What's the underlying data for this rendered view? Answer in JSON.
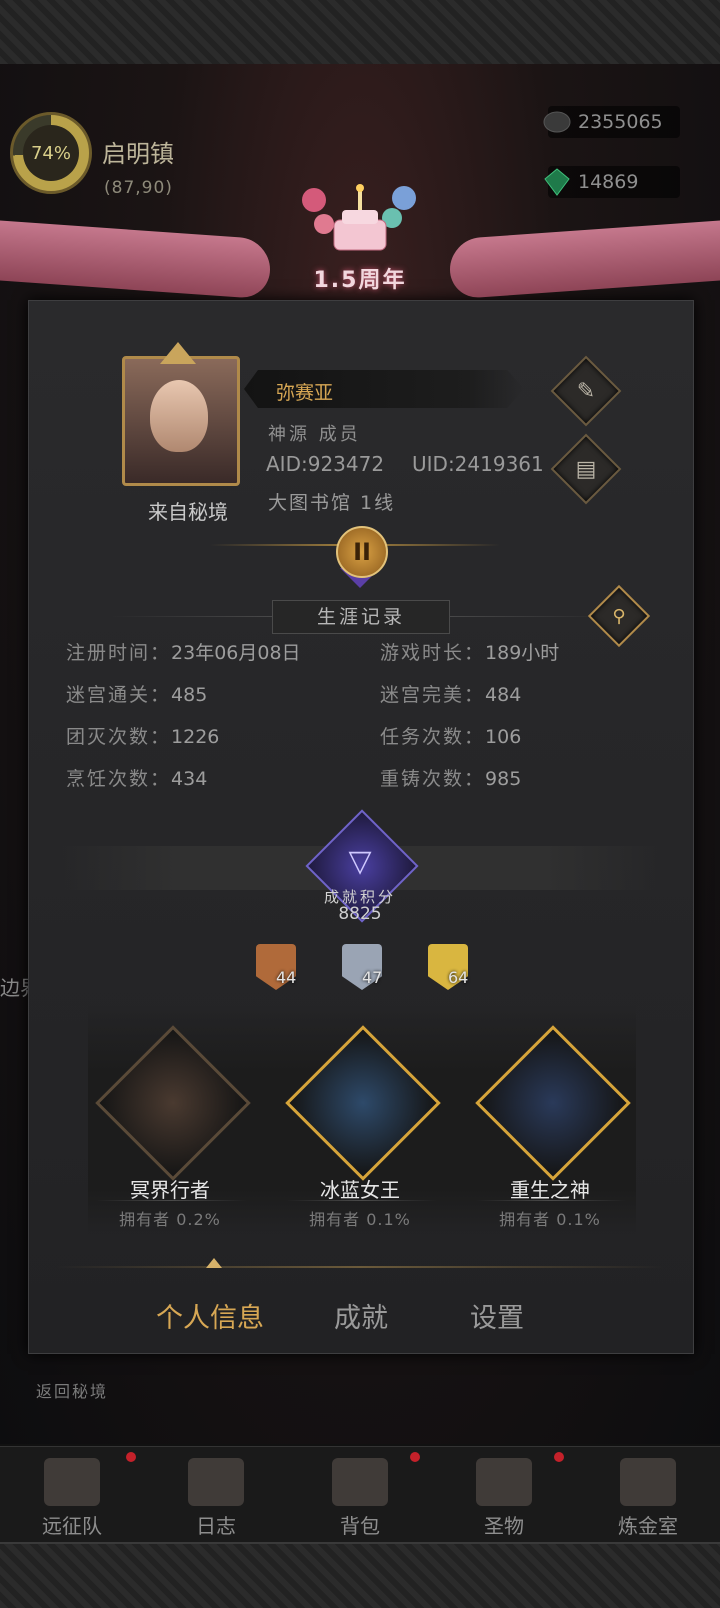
{
  "location": {
    "percent": "74%",
    "name": "启明镇",
    "coords": "(87,90)"
  },
  "currencies": [
    {
      "icon": "stone-icon",
      "value": "2355065"
    },
    {
      "icon": "emerald-icon",
      "value": "14869"
    }
  ],
  "banner": {
    "text": "1.5周年"
  },
  "profile": {
    "name": "弥赛亚",
    "guild": "神源 成员",
    "aid": "AID:923472",
    "uid": "UID:2419361",
    "server": "大图书馆 1线",
    "from": "来自秘境",
    "rank": "II"
  },
  "career": {
    "title": "生涯记录",
    "stats": [
      {
        "label": "注册时间：",
        "value": "23年06月08日"
      },
      {
        "label": "游戏时长：",
        "value": "189小时"
      },
      {
        "label": "迷宫通关：",
        "value": "485"
      },
      {
        "label": "迷宫完美：",
        "value": "484"
      },
      {
        "label": "团灭次数：",
        "value": "1226"
      },
      {
        "label": "任务次数：",
        "value": "106"
      },
      {
        "label": "烹饪次数：",
        "value": "434"
      },
      {
        "label": "重铸次数：",
        "value": "985"
      }
    ]
  },
  "achievement": {
    "label": "成就积分",
    "score": "8825",
    "medals": [
      {
        "tier": "bronze",
        "count": "44",
        "color": "#b06a3a"
      },
      {
        "tier": "silver",
        "count": "47",
        "color": "#9aa4b4"
      },
      {
        "tier": "gold",
        "count": "64",
        "color": "#d9b640"
      }
    ],
    "cards": [
      {
        "name": "冥界行者",
        "owners": "拥有者 0.2%",
        "border": "#5a4a38",
        "fill": "#4a3a30"
      },
      {
        "name": "冰蓝女王",
        "owners": "拥有者 0.1%",
        "border": "#d6a43a",
        "fill": "#2e4a6a"
      },
      {
        "name": "重生之神",
        "owners": "拥有者 0.1%",
        "border": "#d6a43a",
        "fill": "#2a3a5a"
      }
    ]
  },
  "tabs": [
    {
      "label": "个人信息",
      "active": true
    },
    {
      "label": "成就",
      "active": false
    },
    {
      "label": "设置",
      "active": false
    }
  ],
  "return_label": "返回秘境",
  "side_label": "边界",
  "bottom_nav": [
    {
      "label": "远征队",
      "icon": "helmet-icon"
    },
    {
      "label": "日志",
      "icon": "scroll-icon"
    },
    {
      "label": "背包",
      "icon": "bag-icon"
    },
    {
      "label": "圣物",
      "icon": "relic-icon"
    },
    {
      "label": "炼金室",
      "icon": "alchemy-icon"
    }
  ]
}
